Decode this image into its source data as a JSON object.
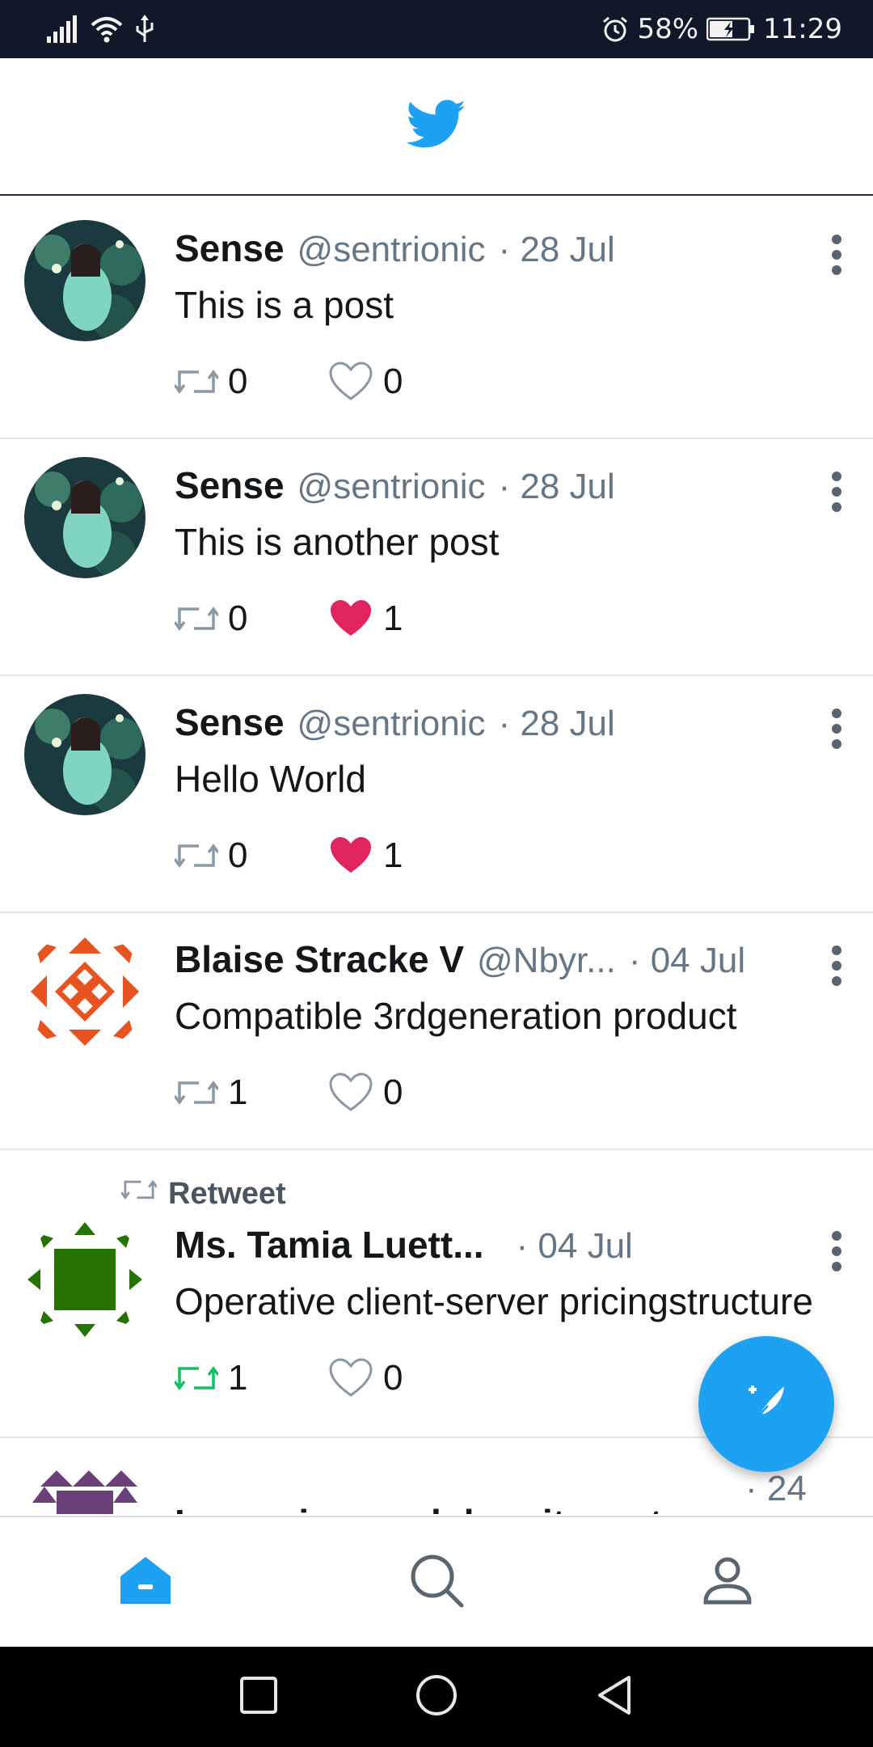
{
  "status_bar": {
    "battery": "58%",
    "time": "11:29",
    "icons": [
      "signal-icon",
      "wifi-icon",
      "usb-icon",
      "alarm-icon",
      "battery-icon"
    ]
  },
  "header": {
    "logo": "twitter-bird-icon"
  },
  "tweets": [
    {
      "name": "Sense",
      "handle": "@sentrionic",
      "date": "· 28 Jul",
      "text": "This is a post",
      "retweets": "0",
      "likes": "0",
      "liked": false,
      "retweeted": false
    },
    {
      "name": "Sense",
      "handle": "@sentrionic",
      "date": "· 28 Jul",
      "text": "This is another post",
      "retweets": "0",
      "likes": "1",
      "liked": true,
      "retweeted": false
    },
    {
      "name": "Sense",
      "handle": "@sentrionic",
      "date": "· 28 Jul",
      "text": "Hello World",
      "retweets": "0",
      "likes": "1",
      "liked": true,
      "retweeted": false
    },
    {
      "name": "Blaise Stracke V",
      "handle": "@Nbyr...",
      "date": "· 04 Jul",
      "text": "Compatible 3rdgeneration product",
      "retweets": "1",
      "likes": "0",
      "liked": false,
      "retweeted": false
    },
    {
      "retweet_label": "Retweet",
      "name": "Ms. Tamia Luett...",
      "handle": "",
      "date": "· 04 Jul",
      "text": "Operative client-server pricingstructure",
      "retweets": "1",
      "likes": "0",
      "liked": false,
      "retweeted": true
    },
    {
      "name": "",
      "handle": "",
      "date": "· 24",
      "text": "Lorem ipsum dolor sit amet"
    }
  ],
  "colors": {
    "accent": "#1da1f2",
    "like_active": "#e0245e",
    "retweet_active": "#17bf63",
    "status_bar": "#10182a",
    "muted": "#657786"
  },
  "bottom_nav": [
    "home-icon",
    "search-icon",
    "profile-icon"
  ],
  "fab": {
    "icon": "compose-tweet-icon"
  }
}
